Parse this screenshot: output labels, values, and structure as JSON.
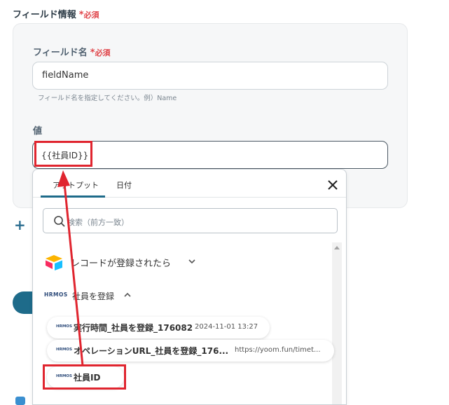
{
  "section": {
    "title": "フィールド情報",
    "required_star": "*",
    "required_label": "必須"
  },
  "field_name": {
    "label": "フィールド名",
    "required_star": "*",
    "required_label": "必須",
    "value": "fieldName",
    "hint": "フィールド名を指定してください。例）Name"
  },
  "value_field": {
    "label": "値",
    "token": "{{社員ID}}"
  },
  "popup": {
    "tabs": [
      "アウトプット",
      "日付"
    ],
    "search_placeholder": "検索（前方一致）",
    "group1": {
      "label": "レコードが登録されたら"
    },
    "group2": {
      "brand": "HRMOS",
      "label": "社員を登録"
    },
    "items": [
      {
        "brand": "HRMOS",
        "label": "実行時間_社員を登録_176082",
        "value": "2024-11-01 13:27"
      },
      {
        "brand": "HRMOS",
        "label": "オペレーションURL_社員を登録_176...",
        "value": "https://yoom.fun/timet..."
      },
      {
        "brand": "HRMOS",
        "label": "社員ID",
        "value": ""
      }
    ]
  },
  "add_symbol": "+",
  "colors": {
    "accent": "#1e6b8a",
    "highlight": "#e0252f",
    "required": "#e0464b"
  }
}
